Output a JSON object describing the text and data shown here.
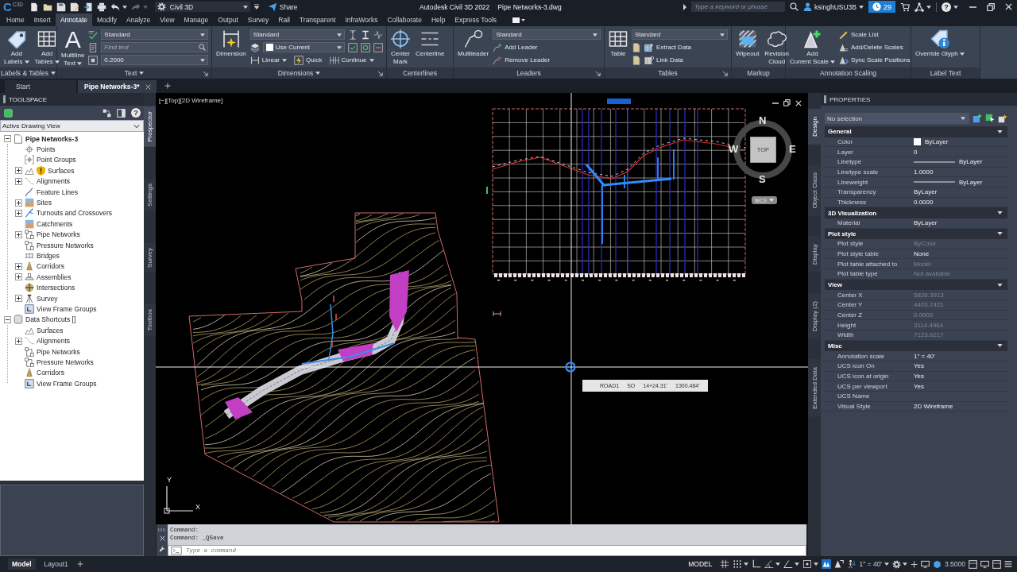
{
  "title_bar": {
    "app_logo": "C",
    "app_badge": "C3D",
    "quick_access": [
      {
        "disabled": false,
        "menu": false
      },
      {
        "disabled": false,
        "menu": false
      },
      {
        "disabled": false,
        "menu": false
      },
      {
        "disabled": false,
        "menu": false
      },
      {
        "disabled": false,
        "menu": false
      },
      {
        "disabled": false,
        "menu": false
      },
      {
        "disabled": false,
        "menu": true
      },
      {
        "disabled": true,
        "menu": true
      }
    ],
    "workspace": "Civil 3D",
    "share": "Share",
    "product": "Autodesk Civil 3D 2022",
    "file_name": "Pipe Networks-3.dwg",
    "search": {
      "placeholder": "Type a keyword or phrase"
    },
    "user_name": "ksinghUSU3B",
    "trial_days": "29",
    "help": "?"
  },
  "ribbon_tabs": [
    {
      "label": "Home",
      "selected": false
    },
    {
      "label": "Insert",
      "selected": false
    },
    {
      "label": "Annotate",
      "selected": true
    },
    {
      "label": "Modify",
      "selected": false
    },
    {
      "label": "Analyze",
      "selected": false
    },
    {
      "label": "View",
      "selected": false
    },
    {
      "label": "Manage",
      "selected": false
    },
    {
      "label": "Output",
      "selected": false
    },
    {
      "label": "Survey",
      "selected": false
    },
    {
      "label": "Rail",
      "selected": false
    },
    {
      "label": "Transparent",
      "selected": false
    },
    {
      "label": "InfraWorks",
      "selected": false
    },
    {
      "label": "Collaborate",
      "selected": false
    },
    {
      "label": "Help",
      "selected": false
    },
    {
      "label": "Express Tools",
      "selected": false
    }
  ],
  "ribbon_panels": [
    {
      "title": "Labels & Tables",
      "menu": true,
      "launcher": false,
      "columns": [
        [
          [
            {
              "kind": "large",
              "label": "Add\nLabels",
              "caret": true
            }
          ]
        ],
        [
          [
            {
              "kind": "large",
              "label": "Add\nTables",
              "caret": true
            }
          ]
        ]
      ]
    },
    {
      "title": "Text",
      "menu": true,
      "launcher": true,
      "columns": [
        [
          [
            {
              "kind": "large",
              "glyph": "A",
              "label": "Multiline\nText",
              "caret": true
            }
          ]
        ],
        [
          [
            {
              "kind": "icon"
            },
            {
              "kind": "combo",
              "value": "Standard"
            }
          ],
          [
            {
              "kind": "icon"
            },
            {
              "kind": "search",
              "placeholder": "Find text"
            }
          ],
          [
            {
              "kind": "icon"
            },
            {
              "kind": "combo",
              "value": "0.2000"
            }
          ]
        ]
      ]
    },
    {
      "title": "Dimensions",
      "menu": true,
      "launcher": true,
      "columns": [
        [
          [
            {
              "kind": "large",
              "label": "Dimension",
              "caret": false
            }
          ]
        ],
        [
          [
            {
              "kind": "combo",
              "value": "Standard"
            },
            {
              "kind": "icon"
            },
            {
              "kind": "icon"
            },
            {
              "kind": "icon"
            }
          ],
          [
            {
              "kind": "icon"
            },
            {
              "kind": "combo",
              "value": "Use Current",
              "color": "#ffffff"
            },
            {
              "kind": "icon"
            },
            {
              "kind": "icon"
            },
            {
              "kind": "icon"
            }
          ],
          [
            {
              "kind": "small",
              "label": "Linear",
              "caret": true
            },
            {
              "kind": "small",
              "label": "Quick",
              "caret": false
            },
            {
              "kind": "small",
              "label": "Continue",
              "caret": true
            }
          ]
        ]
      ]
    },
    {
      "title": "Centerlines",
      "menu": false,
      "launcher": false,
      "columns": [
        [
          [
            {
              "kind": "large",
              "label": "Center\nMark",
              "caret": false
            }
          ]
        ],
        [
          [
            {
              "kind": "large",
              "label": "Centerline",
              "caret": false
            }
          ]
        ]
      ]
    },
    {
      "title": "Leaders",
      "menu": false,
      "launcher": true,
      "columns": [
        [
          [
            {
              "kind": "large",
              "label": "Multileader",
              "caret": false
            }
          ]
        ],
        [
          [
            {
              "kind": "combo",
              "value": "Standard"
            }
          ],
          [
            {
              "kind": "small",
              "label": "Add Leader",
              "caret": false
            }
          ],
          [
            {
              "kind": "small",
              "label": "Remove Leader",
              "caret": false
            }
          ]
        ]
      ]
    },
    {
      "title": "Tables",
      "menu": false,
      "launcher": true,
      "columns": [
        [
          [
            {
              "kind": "large",
              "label": "Table",
              "caret": false
            }
          ]
        ],
        [
          [
            {
              "kind": "combo",
              "value": "Standard"
            }
          ],
          [
            {
              "kind": "icon"
            },
            {
              "kind": "small",
              "label": "Extract Data",
              "caret": false
            }
          ],
          [
            {
              "kind": "icon"
            },
            {
              "kind": "small",
              "label": "Link Data",
              "caret": false
            }
          ]
        ]
      ]
    },
    {
      "title": "Markup",
      "menu": false,
      "launcher": false,
      "columns": [
        [
          [
            {
              "kind": "large",
              "label": "Wipeout",
              "caret": false
            }
          ]
        ],
        [
          [
            {
              "kind": "large",
              "label": "Revision\nCloud",
              "caret": false
            }
          ]
        ]
      ]
    },
    {
      "title": "Annotation Scaling",
      "menu": false,
      "launcher": false,
      "columns": [
        [
          [
            {
              "kind": "large",
              "label": "Add\nCurrent Scale",
              "caret": true
            }
          ]
        ],
        [
          [
            {
              "kind": "small",
              "label": "Scale List",
              "caret": false
            }
          ],
          [
            {
              "kind": "small",
              "label": "Add/Delete Scales",
              "caret": false
            }
          ],
          [
            {
              "kind": "small",
              "label": "Sync Scale Positions",
              "caret": false
            }
          ]
        ]
      ]
    },
    {
      "title": "Label Text",
      "menu": false,
      "launcher": false,
      "columns": [
        [
          [
            {
              "kind": "large",
              "label": "Override Glyph",
              "caret": true
            }
          ]
        ]
      ]
    }
  ],
  "document_tabs": [
    {
      "label": "Start",
      "selected": false,
      "closable": false
    },
    {
      "label": "Pipe Networks-3*",
      "selected": true,
      "closable": true
    }
  ],
  "toolspace": {
    "title": "TOOLSPACE",
    "help": "?",
    "view": "Active Drawing View",
    "tree": [
      {
        "label": "Pipe Networks-3",
        "kind": "branch",
        "expanded": true,
        "current": true,
        "warning": false,
        "children": [
          {
            "label": "Points",
            "kind": "leaf",
            "warning": false
          },
          {
            "label": "Point Groups",
            "kind": "leaf",
            "warning": false
          },
          {
            "label": "Surfaces",
            "kind": "branch",
            "expanded": false,
            "warning": true
          },
          {
            "label": "Alignments",
            "kind": "branch",
            "expanded": false,
            "warning": false
          },
          {
            "label": "Feature Lines",
            "kind": "leaf",
            "warning": false
          },
          {
            "label": "Sites",
            "kind": "branch",
            "expanded": false,
            "warning": false
          },
          {
            "label": "Turnouts and Crossovers",
            "kind": "branch",
            "expanded": false,
            "warning": false
          },
          {
            "label": "Catchments",
            "kind": "leaf",
            "warning": false
          },
          {
            "label": "Pipe Networks",
            "kind": "branch",
            "expanded": false,
            "warning": false
          },
          {
            "label": "Pressure Networks",
            "kind": "leaf",
            "warning": false
          },
          {
            "label": "Bridges",
            "kind": "leaf",
            "warning": false
          },
          {
            "label": "Corridors",
            "kind": "branch",
            "expanded": false,
            "warning": false
          },
          {
            "label": "Assemblies",
            "kind": "branch",
            "expanded": false,
            "warning": false
          },
          {
            "label": "Intersections",
            "kind": "leaf",
            "warning": false
          },
          {
            "label": "Survey",
            "kind": "branch",
            "expanded": false,
            "warning": false
          },
          {
            "label": "View Frame Groups",
            "kind": "leaf",
            "warning": false
          }
        ]
      },
      {
        "label": "Data Shortcuts []",
        "kind": "branch",
        "expanded": true,
        "current": false,
        "warning": false,
        "children": [
          {
            "label": "Surfaces",
            "kind": "leaf",
            "warning": false
          },
          {
            "label": "Alignments",
            "kind": "branch",
            "expanded": false,
            "warning": false
          },
          {
            "label": "Pipe Networks",
            "kind": "leaf",
            "warning": false
          },
          {
            "label": "Pressure Networks",
            "kind": "leaf",
            "warning": false
          },
          {
            "label": "Corridors",
            "kind": "leaf",
            "warning": false
          },
          {
            "label": "View Frame Groups",
            "kind": "leaf",
            "warning": false
          }
        ]
      }
    ],
    "tabs": [
      {
        "label": "Prospector",
        "selected": true
      },
      {
        "label": "Settings",
        "selected": false
      },
      {
        "label": "Survey",
        "selected": false
      },
      {
        "label": "Toolbox",
        "selected": false
      }
    ]
  },
  "viewport": {
    "label": "[−][Top][2D Wireframe]",
    "viewcube": {
      "north": "N",
      "east": "E",
      "south": "S",
      "west": "W",
      "face": "TOP",
      "coordinate_system": "WCS"
    },
    "ucs_labels": {
      "x": "X",
      "y": "Y"
    },
    "tooltip": [
      "ROAD1",
      "SO",
      "14+24.31'",
      "1300.484'"
    ]
  },
  "command_line": {
    "history": [
      "Command:",
      "Command: _QSave"
    ],
    "input": {
      "placeholder": "Type a command"
    }
  },
  "properties": {
    "title": "PROPERTIES",
    "selection": "No selection",
    "tabs": [
      {
        "label": "Design",
        "selected": true
      },
      {
        "label": "Object Class",
        "selected": false
      },
      {
        "label": "Display",
        "selected": false
      },
      {
        "label": "Display (2)",
        "selected": false
      },
      {
        "label": "Extended Data",
        "selected": false
      }
    ],
    "sections": [
      {
        "title": "General",
        "expanded": true,
        "rows": [
          {
            "label": "Color",
            "value": "ByLayer",
            "kind": "swatch",
            "color": "#ffffff",
            "dimmed": false
          },
          {
            "label": "Layer",
            "value": "0",
            "kind": "text",
            "dimmed": false
          },
          {
            "label": "Linetype",
            "value": "ByLayer",
            "kind": "line",
            "dimmed": false
          },
          {
            "label": "Linetype scale",
            "value": "1.0000",
            "kind": "text",
            "dimmed": false
          },
          {
            "label": "Lineweight",
            "value": "ByLayer",
            "kind": "line",
            "dimmed": false
          },
          {
            "label": "Transparency",
            "value": "ByLayer",
            "kind": "text",
            "dimmed": false
          },
          {
            "label": "Thickness",
            "value": "0.0000",
            "kind": "text",
            "dimmed": false
          }
        ]
      },
      {
        "title": "3D Visualization",
        "expanded": true,
        "rows": [
          {
            "label": "Material",
            "value": "ByLayer",
            "kind": "text",
            "dimmed": false
          }
        ]
      },
      {
        "title": "Plot style",
        "expanded": true,
        "rows": [
          {
            "label": "Plot style",
            "value": "ByColor",
            "kind": "text",
            "dimmed": true
          },
          {
            "label": "Plot style table",
            "value": "None",
            "kind": "text",
            "dimmed": false
          },
          {
            "label": "Plot table attached to",
            "value": "Model",
            "kind": "text",
            "dimmed": true
          },
          {
            "label": "Plot table type",
            "value": "Not available",
            "kind": "text",
            "dimmed": true
          }
        ]
      },
      {
        "title": "View",
        "expanded": true,
        "rows": [
          {
            "label": "Center X",
            "value": "5826.3913",
            "kind": "text",
            "dimmed": true
          },
          {
            "label": "Center Y",
            "value": "4403.7421",
            "kind": "text",
            "dimmed": true
          },
          {
            "label": "Center Z",
            "value": "0.0000",
            "kind": "text",
            "dimmed": true
          },
          {
            "label": "Height",
            "value": "3114.4964",
            "kind": "text",
            "dimmed": true
          },
          {
            "label": "Width",
            "value": "7123.6217",
            "kind": "text",
            "dimmed": true
          }
        ]
      },
      {
        "title": "Misc",
        "expanded": true,
        "rows": [
          {
            "label": "Annotation scale",
            "value": "1\" = 40'",
            "kind": "text",
            "dimmed": false
          },
          {
            "label": "UCS icon On",
            "value": "Yes",
            "kind": "text",
            "dimmed": false
          },
          {
            "label": "UCS icon at origin",
            "value": "Yes",
            "kind": "text",
            "dimmed": false
          },
          {
            "label": "UCS per viewport",
            "value": "Yes",
            "kind": "text",
            "dimmed": false
          },
          {
            "label": "UCS Name",
            "kind": "text",
            "dimmed": false
          },
          {
            "label": "Visual Style",
            "value": "2D Wireframe",
            "kind": "text",
            "dimmed": false
          }
        ]
      }
    ]
  },
  "status_bar": {
    "layouts": [
      {
        "label": "Model",
        "selected": true
      },
      {
        "label": "Layout1",
        "selected": false
      }
    ],
    "space": "MODEL",
    "toggles": [
      {
        "on": false,
        "menu": false
      },
      {
        "on": false,
        "menu": true
      },
      {
        "on": false,
        "menu": false
      },
      {
        "on": false,
        "menu": true
      },
      {
        "on": false,
        "menu": true
      },
      {
        "on": false,
        "menu": true
      },
      {
        "on": true,
        "menu": false
      },
      {
        "on": false,
        "menu": false
      }
    ],
    "annotation_scale": "1\" = 40'",
    "readout": "3.5000"
  }
}
